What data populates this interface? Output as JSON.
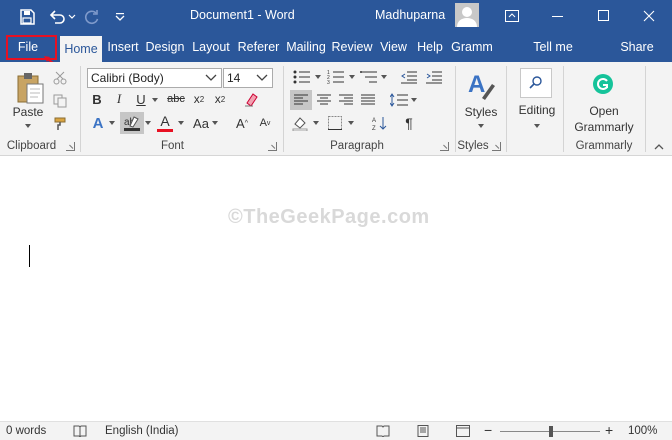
{
  "titlebar": {
    "title": "Document1  -  Word",
    "user": "Madhuparna",
    "icons": [
      "save-icon",
      "undo-icon",
      "redo-icon",
      "customize-qat-icon",
      "ribbon-display-icon",
      "minimize-icon",
      "maximize-icon",
      "close-icon"
    ]
  },
  "tabs": [
    {
      "label": "File"
    },
    {
      "label": "Home"
    },
    {
      "label": "Insert"
    },
    {
      "label": "Design"
    },
    {
      "label": "Layout"
    },
    {
      "label": "Referer"
    },
    {
      "label": "Mailing"
    },
    {
      "label": "Review"
    },
    {
      "label": "View"
    },
    {
      "label": "Help"
    },
    {
      "label": "Gramm"
    },
    {
      "label": "Tell me"
    },
    {
      "label": "Share"
    }
  ],
  "ribbon": {
    "clipboard": {
      "label": "Clipboard",
      "paste": "Paste"
    },
    "font": {
      "label": "Font",
      "font_name": "Calibri (Body)",
      "font_size": "14"
    },
    "paragraph": {
      "label": "Paragraph"
    },
    "styles": {
      "label": "Styles",
      "button": "Styles"
    },
    "editing": {
      "button": "Editing"
    },
    "grammarly": {
      "label": "Grammarly",
      "button_line1": "Open",
      "button_line2": "Grammarly"
    }
  },
  "document": {
    "watermark": "©TheGeekPage.com"
  },
  "status": {
    "words": "0 words",
    "language": "English (India)",
    "zoom": "100%"
  },
  "colors": {
    "brand": "#2b579a",
    "ribbon_bg": "#f3f3f3",
    "highlight_red": "#e81123",
    "font_color_red": "#e81123",
    "grammarly_green": "#15c39a"
  }
}
